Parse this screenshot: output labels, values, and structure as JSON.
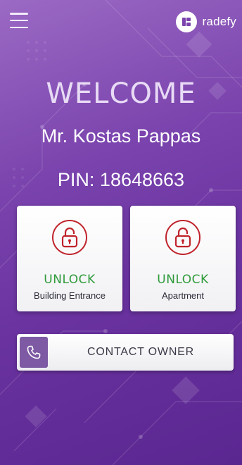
{
  "header": {
    "menu_icon": "hamburger-menu-icon",
    "logo_icon": "radefy-logo-icon",
    "logo_text": "radefy"
  },
  "greeting": {
    "welcome": "WELCOME",
    "name": "Mr. Kostas Pappas",
    "pin": "PIN: 18648663"
  },
  "actions": [
    {
      "title": "UNLOCK",
      "subtitle": "Building Entrance",
      "icon": "padlock-icon"
    },
    {
      "title": "UNLOCK",
      "subtitle": "Apartment",
      "icon": "padlock-icon"
    }
  ],
  "contact": {
    "label": "CONTACT OWNER",
    "icon": "phone-icon"
  },
  "colors": {
    "background": "#7a43ad",
    "lock_red": "#c0232b",
    "unlock_green": "#2f9a3a",
    "phone_box": "#7d5aa3"
  }
}
